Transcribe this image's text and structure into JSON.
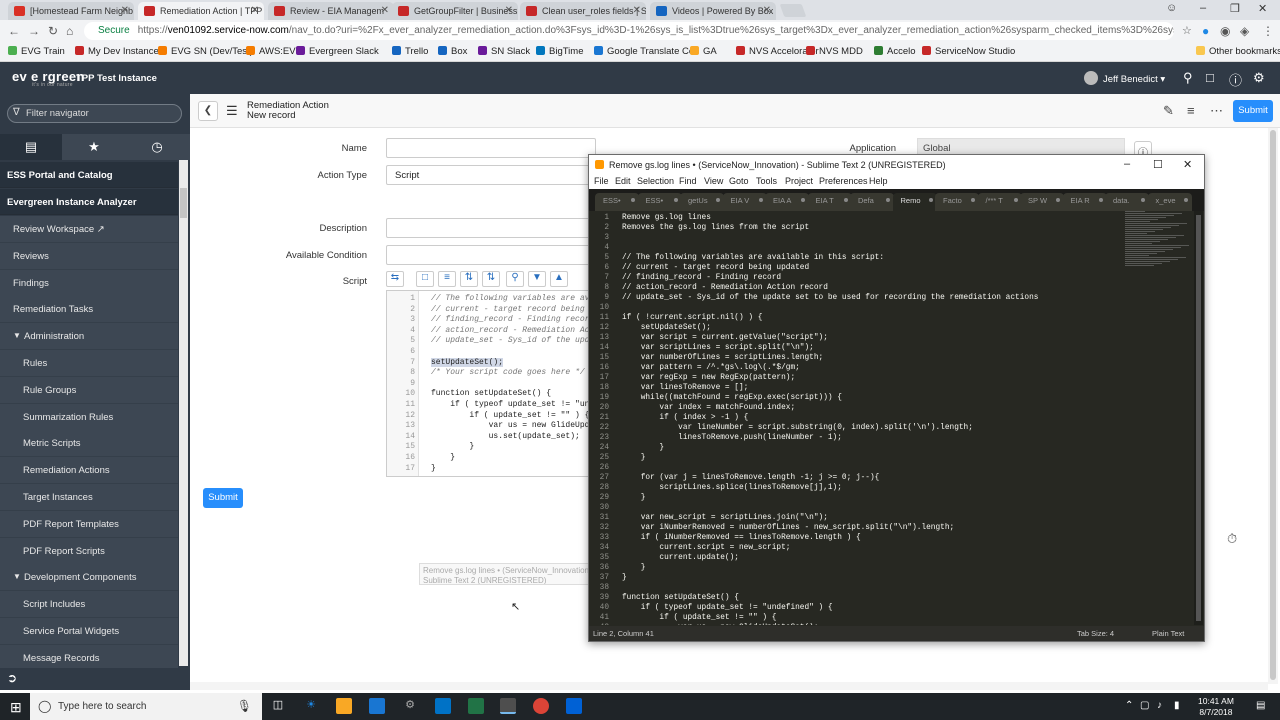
{
  "browser": {
    "tabs": [
      {
        "label": "[Homestead Farm Neighb",
        "color": "#d93025"
      },
      {
        "label": "Remediation Action | TPP",
        "color": "#c62828"
      },
      {
        "label": "Review - EIA Managem",
        "color": "#c62828"
      },
      {
        "label": "GetGroupFilter | Business",
        "color": "#c62828"
      },
      {
        "label": "Clean user_roles fields | S",
        "color": "#c62828"
      },
      {
        "label": "Videos | Powered By Box",
        "color": "#1565c0"
      }
    ],
    "url_secure": "Secure",
    "url_prefix": "https://",
    "url_host": "ven01092.service-now.com",
    "url_rest": "/nav_to.do?uri=%2Fx_ever_analyzer_remediation_action.do%3Fsys_id%3D-1%26sys_is_list%3Dtrue%26sys_target%3Dx_ever_analyzer_remediation_action%26sysparm_checked_items%3D%26sysparm_fixed_query...",
    "bookmarks": [
      {
        "label": "EVG Train",
        "color": "#4caf50"
      },
      {
        "label": "My Dev Instance",
        "color": "#c62828"
      },
      {
        "label": "EVG SN (Dev/Test)",
        "color": "#f57c00"
      },
      {
        "label": "AWS:EVG",
        "color": "#f57c00"
      },
      {
        "label": "Evergreen Slack",
        "color": "#6a1b9a"
      },
      {
        "label": "Trello",
        "color": "#1565c0"
      },
      {
        "label": "Box",
        "color": "#1565c0"
      },
      {
        "label": "SN Slack",
        "color": "#6a1b9a"
      },
      {
        "label": "BigTime",
        "color": "#0277bd"
      },
      {
        "label": "Google Translate Co",
        "color": "#1976d2"
      },
      {
        "label": "GA",
        "color": "#f9a825"
      },
      {
        "label": "NVS Accelorator",
        "color": "#c62828"
      },
      {
        "label": "NVS MDD",
        "color": "#c62828"
      },
      {
        "label": "Accelo",
        "color": "#2e7d32"
      },
      {
        "label": "ServiceNow Studio",
        "color": "#c62828"
      }
    ],
    "other_bookmarks": "Other bookmarks"
  },
  "header": {
    "logo": "ev e rgreen",
    "logo_sub": "it's in our nature",
    "instance": "TPP Test Instance",
    "user": "Jeff Benedict"
  },
  "nav": {
    "filter_placeholder": "Filter navigator",
    "sections": [
      "ESS Portal and Catalog",
      "Evergreen Instance Analyzer"
    ],
    "items": [
      "Review Workspace ↗",
      "Reviews",
      "Findings",
      "Remediation Tasks",
      "Administration",
      "Rules",
      "Rule Groups",
      "Summarization Rules",
      "Metric Scripts",
      "Remediation Actions",
      "Target Instances",
      "PDF Report Templates",
      "PDF Report Scripts",
      "Development Components",
      "Script Includes",
      "Service Portal Widgets",
      "Message Records"
    ]
  },
  "form": {
    "title": "Remediation Action",
    "subtitle": "New record",
    "submit": "Submit",
    "labels": {
      "name": "Name",
      "action_type": "Action Type",
      "description": "Description",
      "available_condition": "Available Condition",
      "script": "Script",
      "application": "Application"
    },
    "action_type_value": "Script",
    "application_value": "Global",
    "tooltip_line1": "Remove gs.log lines • (ServiceNow_Innovation) -",
    "tooltip_line2": "Sublime Text 2 (UNREGISTERED)",
    "script_lines": [
      "// The following variables are avail",
      "// current - target record being up",
      "// finding_record - Finding record",
      "// action_record - Remediation Actio",
      "// update_set - Sys_id of the updat",
      "",
      "setUpdateSet();",
      "/* Your script code goes here */",
      "",
      "function setUpdateSet() {",
      "    if ( typeof update_set != \"unde",
      "        if ( update_set != \"\" ) {",
      "            var us = new GlideUpdate",
      "            us.set(update_set);",
      "        }",
      "    }",
      "}"
    ]
  },
  "sublime": {
    "title": "Remove gs.log lines • (ServiceNow_Innovation) - Sublime Text 2 (UNREGISTERED)",
    "menu": [
      "File",
      "Edit",
      "Selection",
      "Find",
      "View",
      "Goto",
      "Tools",
      "Project",
      "Preferences",
      "Help"
    ],
    "tabs": [
      "ESS•",
      "ESS•",
      "getUs",
      "EIA V",
      "EIA A",
      "EIA T",
      "Defa",
      "Remo",
      "Facto",
      "/*** T",
      "SP W",
      "EIA R",
      "data.",
      "x_eve"
    ],
    "code": [
      "Remove gs.log lines",
      "Removes the gs.log lines from the script",
      "",
      "",
      "// The following variables are available in this script:",
      "// current - target record being updated",
      "// finding_record - Finding record",
      "// action_record - Remediation Action record",
      "// update_set - Sys_id of the update set to be used for recording the remediation actions",
      "",
      "if ( !current.script.nil() ) {",
      "    setUpdateSet();",
      "    var script = current.getValue(\"script\");",
      "    var scriptLines = script.split(\"\\n\");",
      "    var numberOfLines = scriptLines.length;",
      "    var pattern = /^.*gs\\.log\\(.*$/gm;",
      "    var regExp = new RegExp(pattern);",
      "    var linesToRemove = [];",
      "    while((matchFound = regExp.exec(script))) {",
      "        var index = matchFound.index;",
      "        if ( index > -1 ) {",
      "            var lineNumber = script.substring(0, index).split('\\n').length;",
      "            linesToRemove.push(lineNumber - 1);",
      "        }",
      "    }",
      "",
      "    for (var j = linesToRemove.length -1; j >= 0; j--){",
      "        scriptLines.splice(linesToRemove[j],1);",
      "    }",
      "",
      "    var new_script = scriptLines.join(\"\\n\");",
      "    var iNumberRemoved = numberOfLines - new_script.split(\"\\n\").length;",
      "    if ( iNumberRemoved == linesToRemove.length ) {",
      "        current.script = new_script;",
      "        current.update();",
      "    }",
      "}",
      "",
      "function setUpdateSet() {",
      "    if ( typeof update_set != \"undefined\" ) {",
      "        if ( update_set != \"\" ) {",
      "            var us = new GlideUpdateSet();"
    ],
    "status_left": "Line 2, Column 41",
    "status_tab": "Tab Size: 4",
    "status_syntax": "Plain Text"
  },
  "taskbar": {
    "search_placeholder": "Type here to search",
    "time": "10:41 AM",
    "date": "8/7/2018"
  }
}
